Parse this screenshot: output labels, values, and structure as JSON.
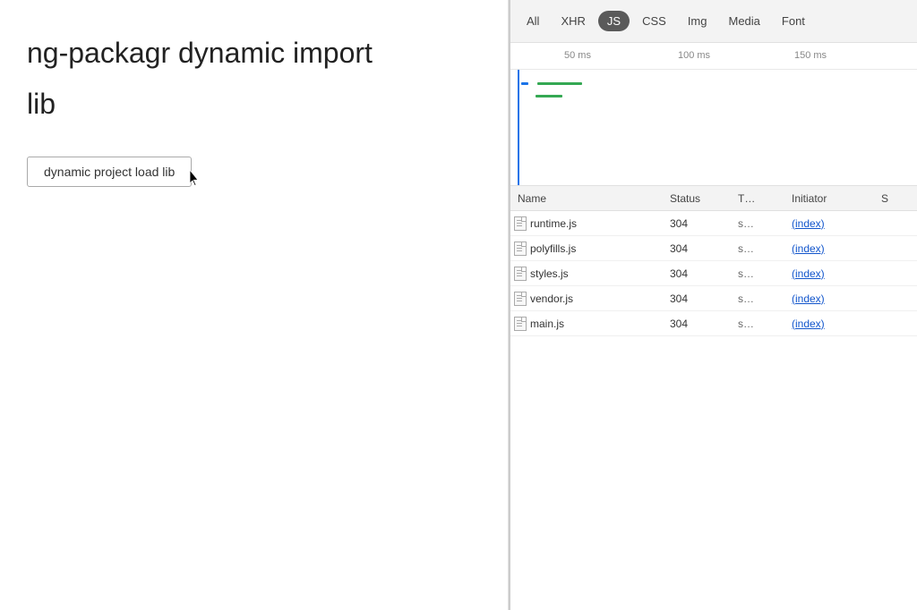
{
  "left": {
    "title": "ng-packagr dynamic import",
    "subtitle": "lib",
    "button_label": "dynamic project load lib"
  },
  "devtools": {
    "tabs": [
      {
        "id": "all",
        "label": "All",
        "active": false
      },
      {
        "id": "xhr",
        "label": "XHR",
        "active": false
      },
      {
        "id": "js",
        "label": "JS",
        "active": true
      },
      {
        "id": "css",
        "label": "CSS",
        "active": false
      },
      {
        "id": "img",
        "label": "Img",
        "active": false
      },
      {
        "id": "media",
        "label": "Media",
        "active": false
      },
      {
        "id": "font",
        "label": "Font",
        "active": false
      }
    ],
    "timeline": {
      "markers": [
        "50 ms",
        "100 ms",
        "150 ms"
      ]
    },
    "table": {
      "headers": [
        "Name",
        "Status",
        "T…",
        "Initiator",
        "S"
      ],
      "rows": [
        {
          "name": "runtime.js",
          "status": "304",
          "type": "s…",
          "initiator": "(index)",
          "size": ""
        },
        {
          "name": "polyfills.js",
          "status": "304",
          "type": "s…",
          "initiator": "(index)",
          "size": ""
        },
        {
          "name": "styles.js",
          "status": "304",
          "type": "s…",
          "initiator": "(index)",
          "size": ""
        },
        {
          "name": "vendor.js",
          "status": "304",
          "type": "s…",
          "initiator": "(index)",
          "size": ""
        },
        {
          "name": "main.js",
          "status": "304",
          "type": "s…",
          "initiator": "(index)",
          "size": ""
        }
      ]
    }
  }
}
